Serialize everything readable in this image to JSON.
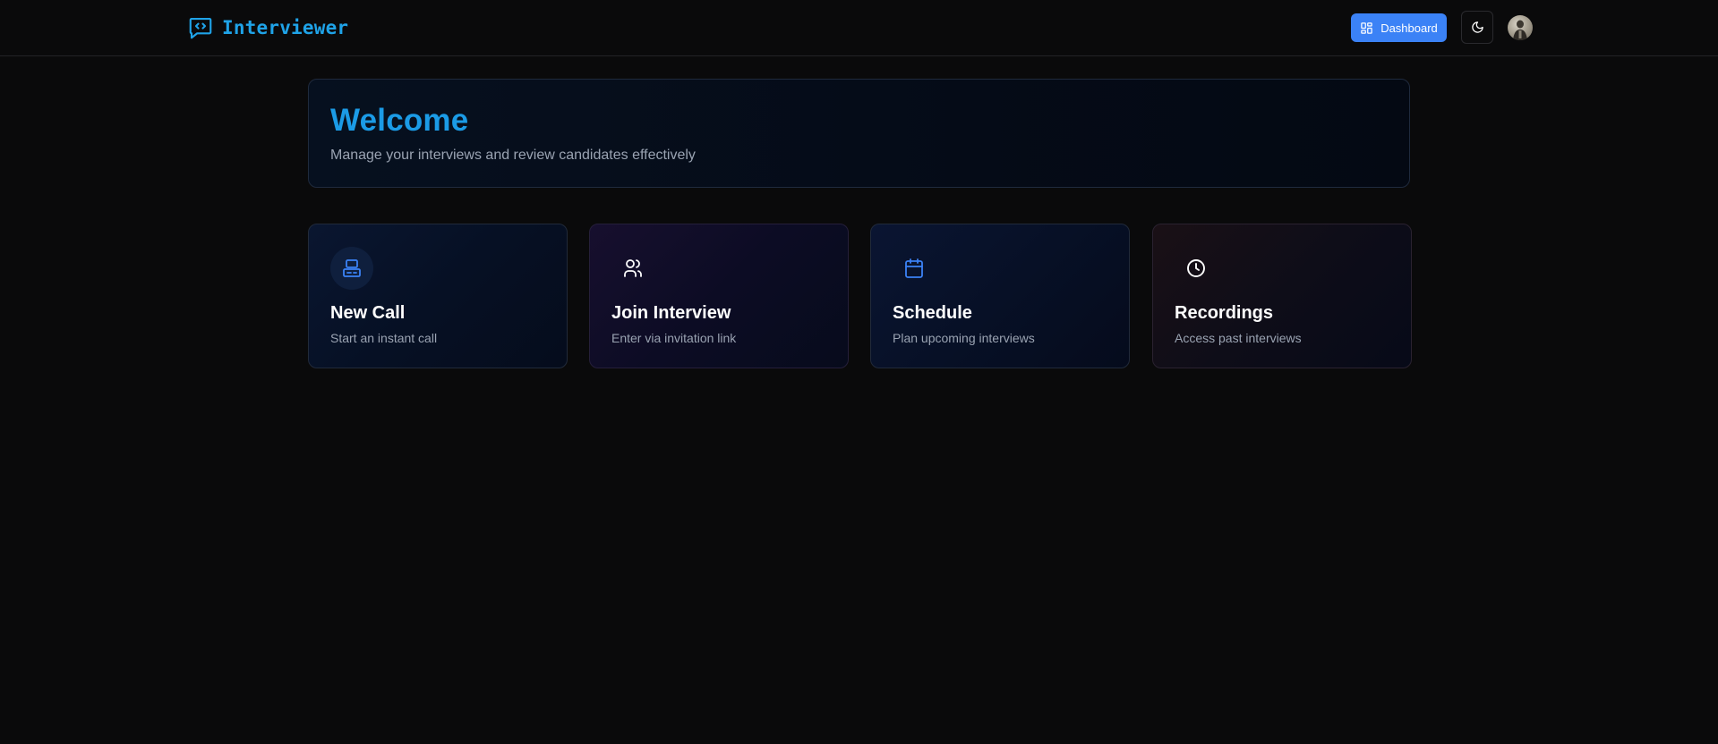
{
  "header": {
    "brand_name": "Interviewer",
    "brand_icon": "code-chat-icon",
    "dashboard_label": "Dashboard",
    "dashboard_icon": "grid-icon",
    "theme_icon": "moon-icon",
    "avatar_icon": "user-avatar"
  },
  "welcome": {
    "title": "Welcome",
    "subtitle": "Manage your interviews and review candidates effectively"
  },
  "actions": [
    {
      "title": "New Call",
      "description": "Start an instant call",
      "icon": "laptop-icon"
    },
    {
      "title": "Join Interview",
      "description": "Enter via invitation link",
      "icon": "users-icon"
    },
    {
      "title": "Schedule",
      "description": "Plan upcoming interviews",
      "icon": "calendar-icon"
    },
    {
      "title": "Recordings",
      "description": "Access past interviews",
      "icon": "clock-icon"
    }
  ],
  "colors": {
    "background": "#0a0a0b",
    "brand": "#1fa3e8",
    "welcome_title": "#1b9be6",
    "primary_button": "#3b82f6",
    "muted_text": "#9aa3b2",
    "icon_blue": "#3b82f6"
  }
}
